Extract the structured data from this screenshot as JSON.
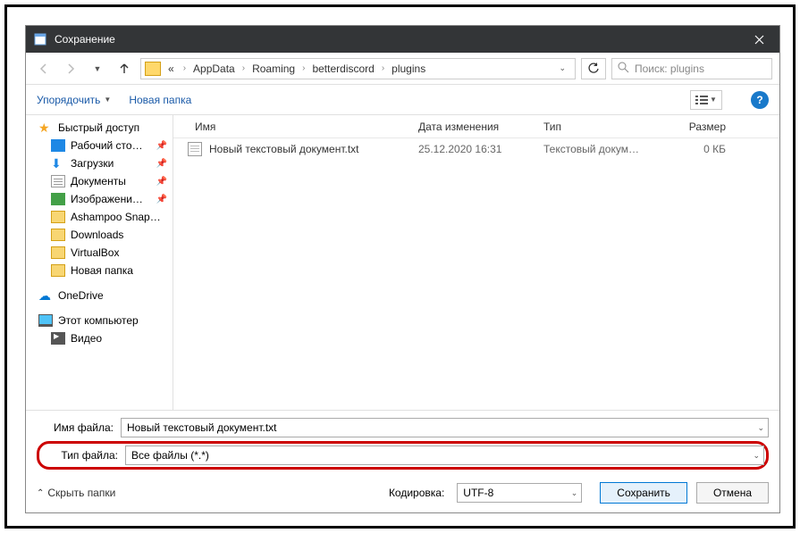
{
  "title": "Сохранение",
  "breadcrumb": {
    "ell": "«",
    "s1": "AppData",
    "s2": "Roaming",
    "s3": "betterdiscord",
    "s4": "plugins"
  },
  "search_placeholder": "Поиск: plugins",
  "toolbar": {
    "organize": "Упорядочить",
    "newfolder": "Новая папка"
  },
  "sidebar": {
    "quick": "Быстрый доступ",
    "desktop": "Рабочий сто…",
    "downloads": "Загрузки",
    "documents": "Документы",
    "pictures": "Изображени…",
    "ashampoo": "Ashampoo Snap…",
    "dlfolder": "Downloads",
    "vbox": "VirtualBox",
    "newf": "Новая папка",
    "onedrive": "OneDrive",
    "thispc": "Этот компьютер",
    "video": "Видео"
  },
  "columns": {
    "name": "Имя",
    "date": "Дата изменения",
    "type": "Тип",
    "size": "Размер"
  },
  "file": {
    "name": "Новый текстовый документ.txt",
    "date": "25.12.2020 16:31",
    "type": "Текстовый докум…",
    "size": "0 КБ"
  },
  "fields": {
    "fname_label": "Имя файла:",
    "fname_value": "Новый текстовый документ.txt",
    "ftype_label": "Тип файла:",
    "ftype_value": "Все файлы  (*.*)"
  },
  "buttons": {
    "hide": "Скрыть папки",
    "enc_label": "Кодировка:",
    "enc_value": "UTF-8",
    "save": "Сохранить",
    "cancel": "Отмена"
  }
}
